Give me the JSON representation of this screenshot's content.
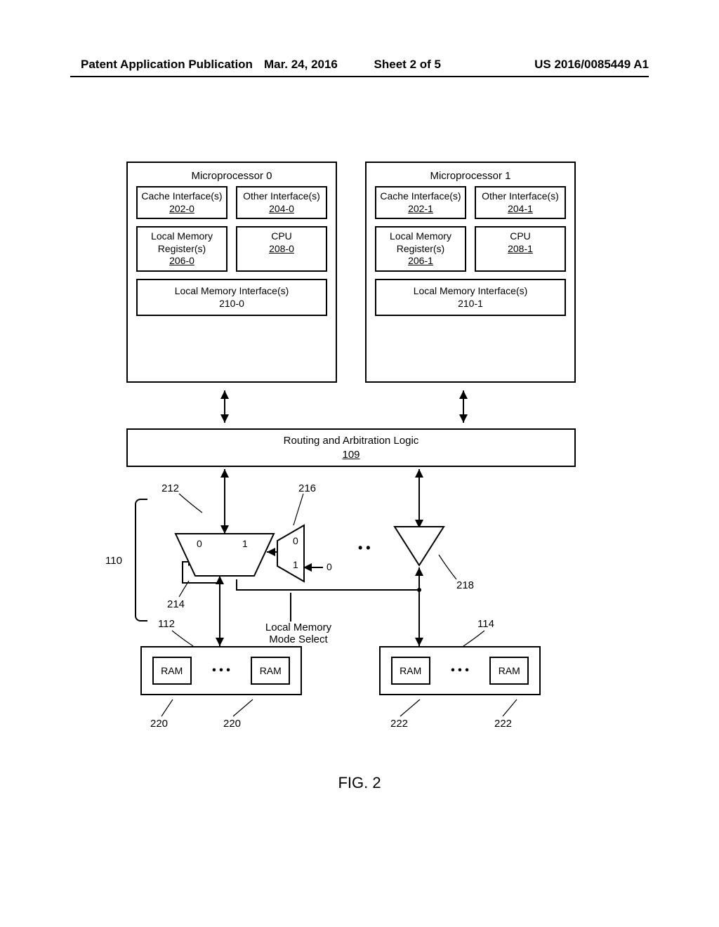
{
  "header": {
    "left": "Patent Application Publication",
    "date": "Mar. 24, 2016",
    "sheet": "Sheet 2 of 5",
    "pubno": "US 2016/0085449 A1"
  },
  "figure_label": "FIG. 2",
  "mpu0": {
    "title": "Microprocessor 0",
    "cache": "Cache Interface(s)",
    "cache_ref": "202-0",
    "other": "Other Interface(s)",
    "other_ref": "204-0",
    "lmr": "Local Memory Register(s)",
    "lmr_ref": "206-0",
    "cpu": "CPU",
    "cpu_ref": "208-0",
    "lmi": "Local Memory Interface(s)",
    "lmi_ref": "210-0"
  },
  "mpu1": {
    "title": "Microprocessor 1",
    "cache": "Cache Interface(s)",
    "cache_ref": "202-1",
    "other": "Other Interface(s)",
    "other_ref": "204-1",
    "lmr": "Local Memory Register(s)",
    "lmr_ref": "206-1",
    "cpu": "CPU",
    "cpu_ref": "208-1",
    "lmi": "Local Memory Interface(s)",
    "lmi_ref": "210-1"
  },
  "ral": {
    "text": "Routing and Arbitration Logic",
    "ref": "109"
  },
  "routing": {
    "block_ref": "110",
    "mux": {
      "ref_box": "212",
      "in0": "0",
      "in1": "1",
      "loop_ref": "214"
    },
    "smux": {
      "ref": "216",
      "in0": "0",
      "in1": "1",
      "sel": "0"
    },
    "buf_ref": "218",
    "mode_select": "Local Memory Mode Select"
  },
  "ramgrp0": {
    "ref": "112",
    "ram": "RAM",
    "item_ref": "220"
  },
  "ramgrp1": {
    "ref": "114",
    "ram": "RAM",
    "item_ref": "222"
  }
}
